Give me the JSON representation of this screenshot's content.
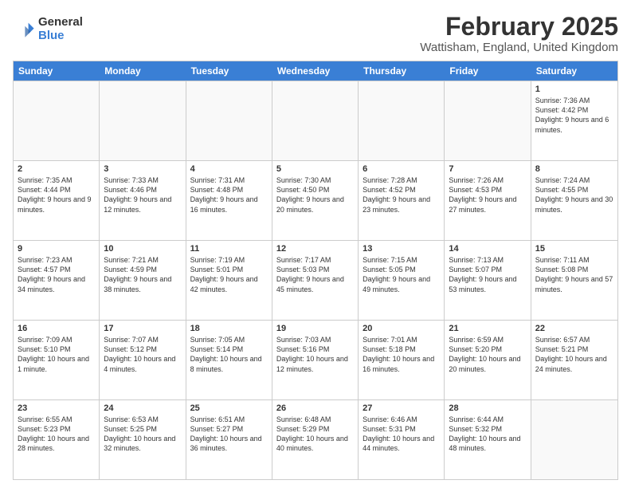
{
  "logo": {
    "general": "General",
    "blue": "Blue"
  },
  "title": "February 2025",
  "location": "Wattisham, England, United Kingdom",
  "days_header": [
    "Sunday",
    "Monday",
    "Tuesday",
    "Wednesday",
    "Thursday",
    "Friday",
    "Saturday"
  ],
  "weeks": [
    [
      {
        "day": "",
        "info": ""
      },
      {
        "day": "",
        "info": ""
      },
      {
        "day": "",
        "info": ""
      },
      {
        "day": "",
        "info": ""
      },
      {
        "day": "",
        "info": ""
      },
      {
        "day": "",
        "info": ""
      },
      {
        "day": "1",
        "info": "Sunrise: 7:36 AM\nSunset: 4:42 PM\nDaylight: 9 hours and 6 minutes."
      }
    ],
    [
      {
        "day": "2",
        "info": "Sunrise: 7:35 AM\nSunset: 4:44 PM\nDaylight: 9 hours and 9 minutes."
      },
      {
        "day": "3",
        "info": "Sunrise: 7:33 AM\nSunset: 4:46 PM\nDaylight: 9 hours and 12 minutes."
      },
      {
        "day": "4",
        "info": "Sunrise: 7:31 AM\nSunset: 4:48 PM\nDaylight: 9 hours and 16 minutes."
      },
      {
        "day": "5",
        "info": "Sunrise: 7:30 AM\nSunset: 4:50 PM\nDaylight: 9 hours and 20 minutes."
      },
      {
        "day": "6",
        "info": "Sunrise: 7:28 AM\nSunset: 4:52 PM\nDaylight: 9 hours and 23 minutes."
      },
      {
        "day": "7",
        "info": "Sunrise: 7:26 AM\nSunset: 4:53 PM\nDaylight: 9 hours and 27 minutes."
      },
      {
        "day": "8",
        "info": "Sunrise: 7:24 AM\nSunset: 4:55 PM\nDaylight: 9 hours and 30 minutes."
      }
    ],
    [
      {
        "day": "9",
        "info": "Sunrise: 7:23 AM\nSunset: 4:57 PM\nDaylight: 9 hours and 34 minutes."
      },
      {
        "day": "10",
        "info": "Sunrise: 7:21 AM\nSunset: 4:59 PM\nDaylight: 9 hours and 38 minutes."
      },
      {
        "day": "11",
        "info": "Sunrise: 7:19 AM\nSunset: 5:01 PM\nDaylight: 9 hours and 42 minutes."
      },
      {
        "day": "12",
        "info": "Sunrise: 7:17 AM\nSunset: 5:03 PM\nDaylight: 9 hours and 45 minutes."
      },
      {
        "day": "13",
        "info": "Sunrise: 7:15 AM\nSunset: 5:05 PM\nDaylight: 9 hours and 49 minutes."
      },
      {
        "day": "14",
        "info": "Sunrise: 7:13 AM\nSunset: 5:07 PM\nDaylight: 9 hours and 53 minutes."
      },
      {
        "day": "15",
        "info": "Sunrise: 7:11 AM\nSunset: 5:08 PM\nDaylight: 9 hours and 57 minutes."
      }
    ],
    [
      {
        "day": "16",
        "info": "Sunrise: 7:09 AM\nSunset: 5:10 PM\nDaylight: 10 hours and 1 minute."
      },
      {
        "day": "17",
        "info": "Sunrise: 7:07 AM\nSunset: 5:12 PM\nDaylight: 10 hours and 4 minutes."
      },
      {
        "day": "18",
        "info": "Sunrise: 7:05 AM\nSunset: 5:14 PM\nDaylight: 10 hours and 8 minutes."
      },
      {
        "day": "19",
        "info": "Sunrise: 7:03 AM\nSunset: 5:16 PM\nDaylight: 10 hours and 12 minutes."
      },
      {
        "day": "20",
        "info": "Sunrise: 7:01 AM\nSunset: 5:18 PM\nDaylight: 10 hours and 16 minutes."
      },
      {
        "day": "21",
        "info": "Sunrise: 6:59 AM\nSunset: 5:20 PM\nDaylight: 10 hours and 20 minutes."
      },
      {
        "day": "22",
        "info": "Sunrise: 6:57 AM\nSunset: 5:21 PM\nDaylight: 10 hours and 24 minutes."
      }
    ],
    [
      {
        "day": "23",
        "info": "Sunrise: 6:55 AM\nSunset: 5:23 PM\nDaylight: 10 hours and 28 minutes."
      },
      {
        "day": "24",
        "info": "Sunrise: 6:53 AM\nSunset: 5:25 PM\nDaylight: 10 hours and 32 minutes."
      },
      {
        "day": "25",
        "info": "Sunrise: 6:51 AM\nSunset: 5:27 PM\nDaylight: 10 hours and 36 minutes."
      },
      {
        "day": "26",
        "info": "Sunrise: 6:48 AM\nSunset: 5:29 PM\nDaylight: 10 hours and 40 minutes."
      },
      {
        "day": "27",
        "info": "Sunrise: 6:46 AM\nSunset: 5:31 PM\nDaylight: 10 hours and 44 minutes."
      },
      {
        "day": "28",
        "info": "Sunrise: 6:44 AM\nSunset: 5:32 PM\nDaylight: 10 hours and 48 minutes."
      },
      {
        "day": "",
        "info": ""
      }
    ]
  ]
}
